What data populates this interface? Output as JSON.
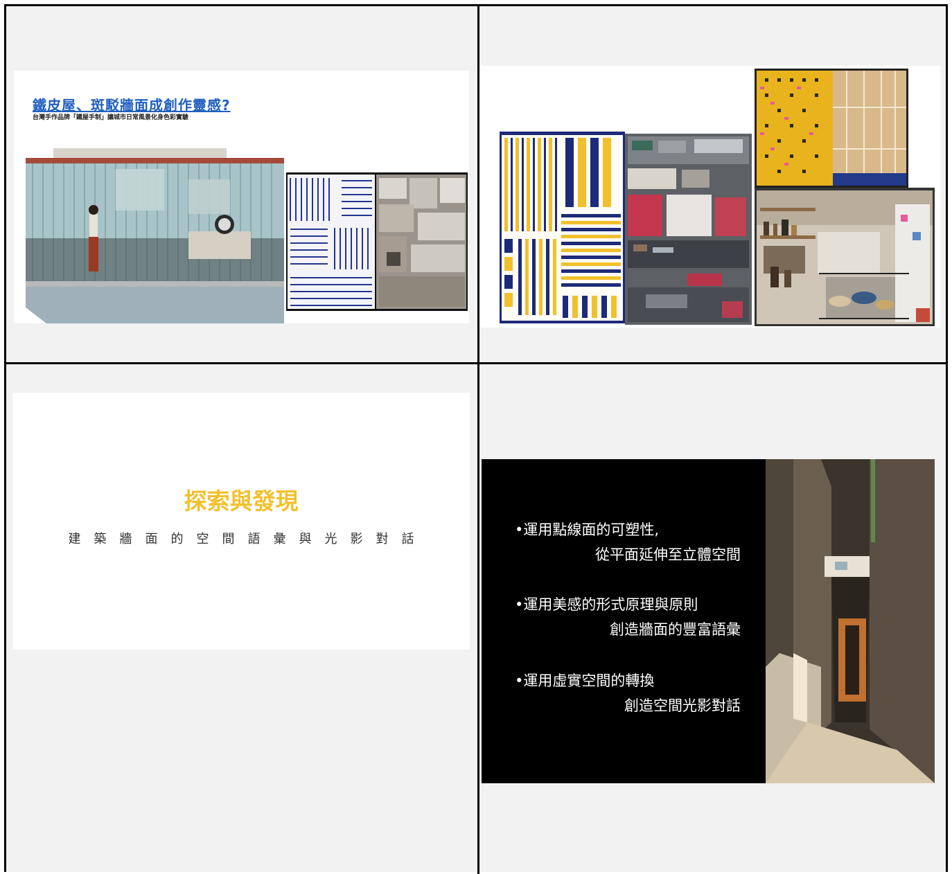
{
  "slide1": {
    "title": "鐵皮屋、斑駁牆面成創作靈感?",
    "subtitle": "台灣手作品牌「鐵屋手制」讓城市日常風景化身色彩實驗"
  },
  "slide3": {
    "title": "探索與發現",
    "subtitle": "建築牆面的空間語彙與光影對話"
  },
  "slide4": {
    "bullets": [
      {
        "line1": "•運用點線面的可塑性,",
        "line2": "從平面延伸至立體空間"
      },
      {
        "line1": "•運用美感的形式原理與原則",
        "line2": "創造牆面的豐富語彙"
      },
      {
        "line1": "•運用虛實空間的轉換",
        "line2": "創造空間光影對話"
      }
    ]
  },
  "colors": {
    "title_blue": "#1f5fbf",
    "accent_yellow": "#f2c02c",
    "navy": "#1d2a78",
    "slide4_bg": "#000000"
  }
}
